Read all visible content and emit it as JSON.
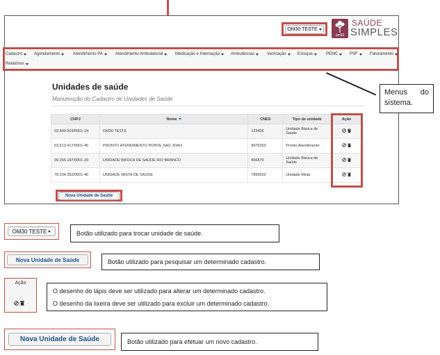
{
  "header": {
    "unit_button": "OM30 TESTE",
    "logo_mark_text": "om30",
    "logo_word_1": "SAÚDE",
    "logo_word_2": "SIMPLES"
  },
  "nav": {
    "items": [
      {
        "label": "Cadastro"
      },
      {
        "label": "Agendamento"
      },
      {
        "label": "Atendimento PA"
      },
      {
        "label": "Atendimento Ambulatorial"
      },
      {
        "label": "Medicação e Internação"
      },
      {
        "label": "Ambulâncias"
      },
      {
        "label": "Vacinação"
      },
      {
        "label": "Estoque"
      },
      {
        "label": "PEMC"
      },
      {
        "label": "PSF"
      },
      {
        "label": "Faturamento"
      },
      {
        "label": "Relatórios"
      }
    ]
  },
  "page": {
    "title": "Unidades de saúde",
    "subtitle": "Manutenção do Cadastro de Unidades de Saúde"
  },
  "table": {
    "columns": [
      "CNPJ",
      "Nome",
      "CNES",
      "Tipo de unidade",
      "Ação"
    ],
    "rows": [
      {
        "cnpj": "03.849.503/0001-24",
        "nome": "OM30 TESTE",
        "cnes": "123456",
        "tipo": "Unidade Básica de Saúde"
      },
      {
        "cnpj": "63.613.417/0001-40",
        "nome": "PRONTO ATENDIMENTO PONTE SAO JOAO",
        "cnes": "8976253",
        "tipo": "Pronto Atendimento"
      },
      {
        "cnpj": "09.265.187/0001-20",
        "nome": "UNIDADE BASICA DE SAUDE RIO BRANCO",
        "cnes": "456879",
        "tipo": "Unidade Básica de Saúde"
      },
      {
        "cnpj": "78.234.392/0001-40",
        "nome": "UNIDADE MISTA DE SAUDE",
        "cnes": "7895632",
        "tipo": "Unidade Mista"
      }
    ]
  },
  "new_button": "Nova Unidade de Saúde",
  "callout": "Menus do sistema.",
  "legend": {
    "unit_text": "Botão utilizado para trocar unidade de saúde.",
    "search_text": "Botão utilizado para pesquisar um determinado cadastro.",
    "action_header": "Ação",
    "action_line1": "O desenho do lápis deve ser utilizado para alterar um determinado cadastro.",
    "action_line2": "O desenho da lixeira deve ser utilizado para excluir um determinado cadastro.",
    "new_text": "Botão utilizado para efetuar um novo cadastro."
  },
  "colors": {
    "highlight": "#c0504d",
    "brand": "#8a3b54",
    "link": "#1a4d8f"
  }
}
